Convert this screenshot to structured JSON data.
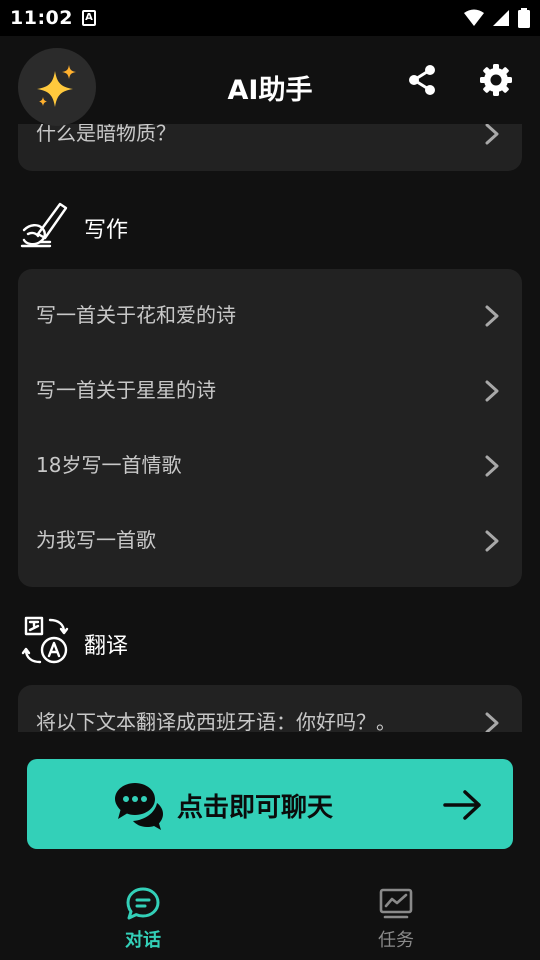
{
  "status_bar": {
    "time": "11:02",
    "notification_badge": "A"
  },
  "header": {
    "title": "AI助手",
    "logo_icon": "sparkles-icon",
    "share_icon": "share-icon",
    "settings_icon": "gear-icon"
  },
  "sections": [
    {
      "label": "",
      "icon": "",
      "items": [
        "什么是暗物质？"
      ]
    },
    {
      "label": "写作",
      "icon": "writing-hand-icon",
      "items": [
        "写一首关于花和爱的诗",
        "写一首关于星星的诗",
        "18岁写一首情歌",
        "为我写一首歌"
      ]
    },
    {
      "label": "翻译",
      "icon": "translate-icon",
      "items": [
        "将以下文本翻译成西班牙语：你好吗？。"
      ]
    }
  ],
  "chat_button": {
    "label": "点击即可聊天",
    "icon": "chat-bubbles-icon",
    "arrow_icon": "arrow-right-icon"
  },
  "bottom_nav": {
    "items": [
      {
        "label": "对话",
        "icon": "chat-icon",
        "active": true
      },
      {
        "label": "任务",
        "icon": "chart-monitor-icon",
        "active": false
      }
    ]
  },
  "colors": {
    "accent": "#33d0b8",
    "background": "#111111",
    "card": "#222222",
    "text_secondary": "#c8c8c8"
  }
}
